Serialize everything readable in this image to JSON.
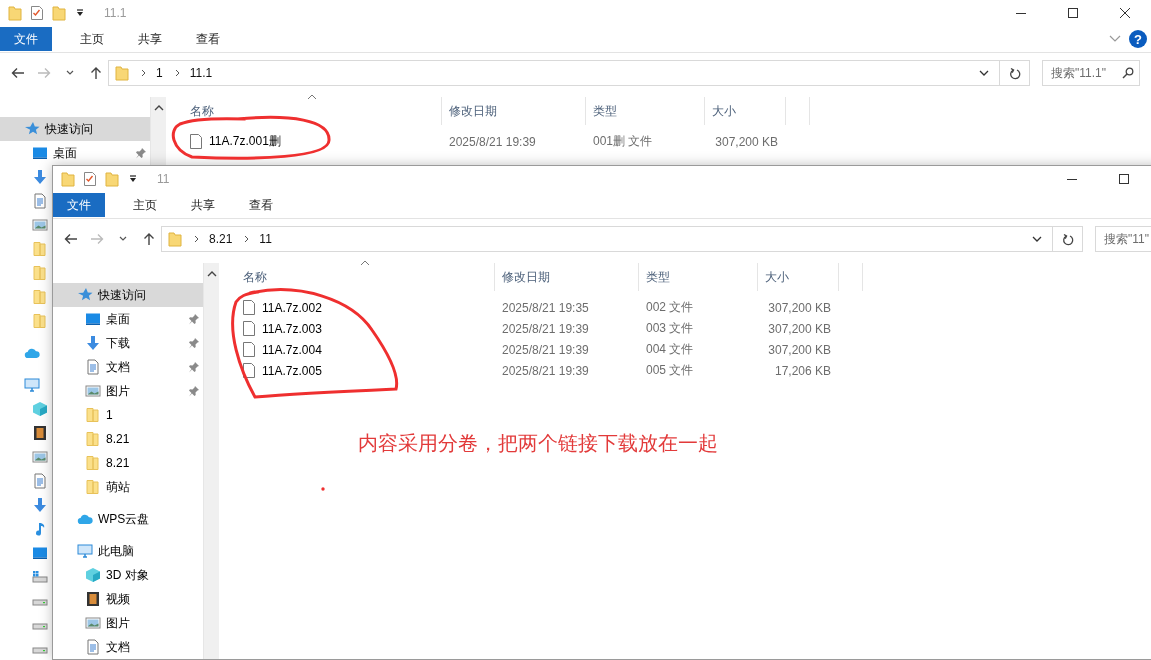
{
  "windows": [
    {
      "title": "11.1",
      "controls": [
        {
          "kind": "minimize"
        },
        {
          "kind": "maximize"
        },
        {
          "kind": "close"
        }
      ],
      "ribbon_tabs": [
        {
          "label": "文件",
          "kind": "file-menu"
        },
        {
          "label": "主页",
          "kind": "tab"
        },
        {
          "label": "共享",
          "kind": "tab"
        },
        {
          "label": "查看",
          "kind": "tab"
        }
      ],
      "ribbon_toggle": true,
      "help": "?",
      "path": [
        "1",
        "11.1"
      ],
      "search": {
        "placeholder": "搜索\"11.1\"",
        "icon": true
      },
      "sidebar": [
        {
          "label": "快速访问",
          "kind": "star",
          "selected": true,
          "children": [
            {
              "label": "桌面",
              "kind": "desktop",
              "selected": false,
              "pinned": true
            },
            {
              "kind": "download"
            },
            {
              "kind": "document"
            },
            {
              "kind": "picture"
            },
            {
              "kind": "folder"
            },
            {
              "kind": "folder"
            },
            {
              "kind": "folder"
            },
            {
              "kind": "folder"
            }
          ]
        },
        {
          "kind": "cloud"
        },
        {
          "kind": "computer",
          "children": [
            {
              "kind": "cube"
            },
            {
              "kind": "video"
            },
            {
              "kind": "picture"
            },
            {
              "kind": "document"
            },
            {
              "kind": "download"
            },
            {
              "kind": "music"
            },
            {
              "kind": "desktop"
            },
            {
              "kind": "drive-windows"
            },
            {
              "kind": "drive"
            },
            {
              "kind": "drive"
            },
            {
              "kind": "drive"
            }
          ]
        }
      ],
      "columns": [
        {
          "label": "名称",
          "sorted": true
        },
        {
          "label": "修改日期",
          "sorted": false
        },
        {
          "label": "类型",
          "sorted": false
        },
        {
          "label": "大小",
          "sorted": false
        }
      ],
      "rows": [
        {
          "name": "11A.7z.001删",
          "modified": "2025/8/21 19:39",
          "type": "001删 文件",
          "size": "307,200 KB"
        }
      ]
    },
    {
      "title": "11",
      "controls": [
        {
          "kind": "minimize"
        },
        {
          "kind": "maximize"
        }
      ],
      "ribbon_tabs": [
        {
          "label": "文件",
          "kind": "file-menu"
        },
        {
          "label": "主页",
          "kind": "tab"
        },
        {
          "label": "共享",
          "kind": "tab"
        },
        {
          "label": "查看",
          "kind": "tab"
        }
      ],
      "path": [
        "8.21",
        "11"
      ],
      "search": {
        "placeholder": "搜索\"11\""
      },
      "sidebar": [
        {
          "label": "快速访问",
          "kind": "star",
          "selected": true,
          "children": [
            {
              "label": "桌面",
              "kind": "desktop",
              "selected": false,
              "pinned": true
            },
            {
              "label": "下载",
              "kind": "download",
              "selected": false,
              "pinned": true
            },
            {
              "label": "文档",
              "kind": "document",
              "selected": false,
              "pinned": true
            },
            {
              "label": "图片",
              "kind": "picture",
              "selected": false,
              "pinned": true
            },
            {
              "label": "1",
              "kind": "folder",
              "selected": false,
              "pinned": false
            },
            {
              "label": "8.21",
              "kind": "folder",
              "selected": false,
              "pinned": false
            },
            {
              "label": "8.21",
              "kind": "folder",
              "selected": false,
              "pinned": false
            },
            {
              "label": "萌站",
              "kind": "folder",
              "selected": false,
              "pinned": false
            }
          ]
        },
        {
          "label": "WPS云盘",
          "kind": "cloud",
          "selected": false
        },
        {
          "label": "此电脑",
          "kind": "computer",
          "selected": false,
          "children": [
            {
              "label": "3D 对象",
              "kind": "cube",
              "selected": false
            },
            {
              "label": "视频",
              "kind": "video",
              "selected": false
            },
            {
              "label": "图片",
              "kind": "picture",
              "selected": false
            },
            {
              "label": "文档",
              "kind": "document",
              "selected": false
            }
          ]
        }
      ],
      "columns": [
        {
          "label": "名称",
          "sorted": true
        },
        {
          "label": "修改日期",
          "sorted": false
        },
        {
          "label": "类型",
          "sorted": false
        },
        {
          "label": "大小",
          "sorted": false
        }
      ],
      "rows": [
        {
          "name": "11A.7z.002",
          "modified": "2025/8/21 19:35",
          "type": "002 文件",
          "size": "307,200 KB"
        },
        {
          "name": "11A.7z.003",
          "modified": "2025/8/21 19:39",
          "type": "003 文件",
          "size": "307,200 KB"
        },
        {
          "name": "11A.7z.004",
          "modified": "2025/8/21 19:39",
          "type": "004 文件",
          "size": "307,200 KB"
        },
        {
          "name": "11A.7z.005",
          "modified": "2025/8/21 19:39",
          "type": "005 文件",
          "size": "17,206 KB"
        }
      ]
    }
  ],
  "annotation": {
    "text": "内容采用分卷，把两个链接下载放在一起"
  }
}
